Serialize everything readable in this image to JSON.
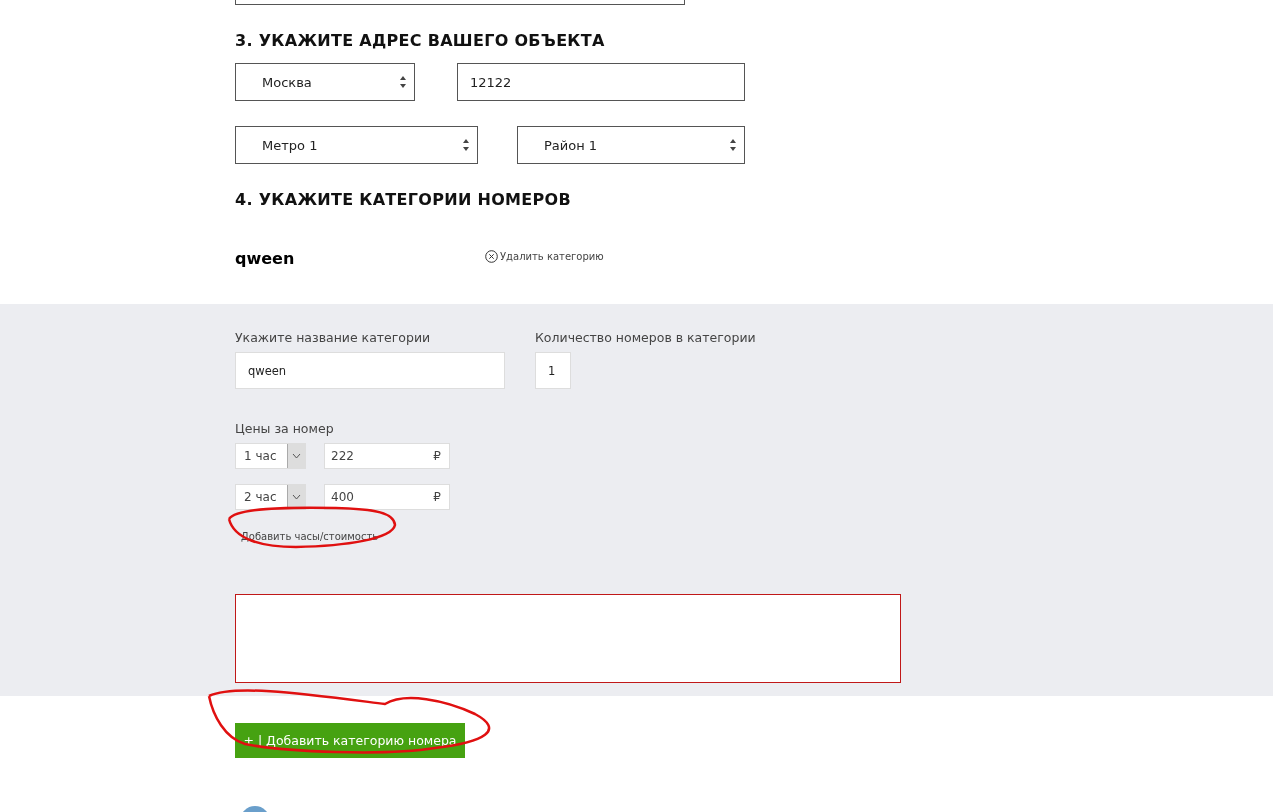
{
  "address": {
    "title": "3. УКАЖИТЕ АДРЕС ВАШЕГО ОБЪЕКТА",
    "city": "Москва",
    "zip": "12122",
    "metro": "Метро 1",
    "district": "Район 1"
  },
  "categories": {
    "title": "4. УКАЖИТЕ КАТЕГОРИИ НОМЕРОВ",
    "name": "qween",
    "delete_label": "Удалить категорию",
    "name_label": "Укажите название категории",
    "name_value": "qween",
    "count_label": "Количество номеров в категории",
    "count_value": "1",
    "prices_label": "Цены за номер",
    "prices": [
      {
        "hours": "1 час",
        "price": "222",
        "currency": "₽"
      },
      {
        "hours": "2 час",
        "price": "400",
        "currency": "₽"
      }
    ],
    "add_price_link": "Добавить часы/стоимость",
    "add_button": "+ | Добавить категорию номера"
  }
}
